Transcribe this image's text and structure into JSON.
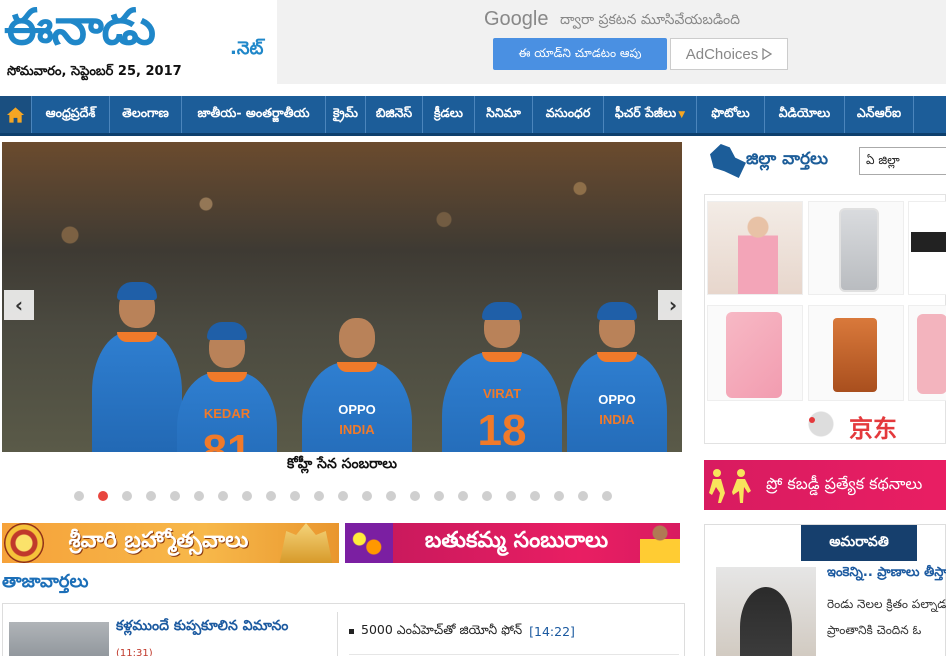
{
  "header": {
    "logo_main": "ఈనాడు",
    "logo_suffix": ".నెట్",
    "date": "సోమవారం, సెప్టెంబర్ 25, 2017",
    "ad": {
      "google": "Google",
      "google_text": "ద్వారా ప్రకటన మూసివేయబడింది",
      "view_button": "ఈ యాడ్‌ని చూడటం ఆపు",
      "adchoices": "AdChoices"
    }
  },
  "nav": {
    "home_icon": "home-icon",
    "items": [
      {
        "label": "ఆంధ్రప్రదేశ్"
      },
      {
        "label": "తెలంగాణ"
      },
      {
        "label": "జాతీయ- అంతర్జాతీయ"
      },
      {
        "label": "క్రైమ్"
      },
      {
        "label": "బిజినెస్"
      },
      {
        "label": "క్రీడలు"
      },
      {
        "label": "సినిమా"
      },
      {
        "label": "వసుంధర"
      },
      {
        "label": "ఫీచర్ పేజీలు"
      },
      {
        "label": "ఫొటోలు"
      },
      {
        "label": "వీడియోలు"
      },
      {
        "label": "ఎన్ఆర్ఐ"
      }
    ],
    "accent": "#1c5d99"
  },
  "slider": {
    "caption": "కోహ్లీ సేన సంబరాలు",
    "prev": "‹",
    "next": "›",
    "dot_count": 23,
    "active_dot": 2,
    "players": [
      {
        "name": "KEDAR",
        "number": "81"
      },
      {
        "name": "VIRAT",
        "number": "18"
      }
    ],
    "jersey_text": "INDIA",
    "sponsor": "OPPO"
  },
  "banners": {
    "left": "శ్రీవారి బ్రహ్మోత్సవాలు",
    "right": "బతుకమ్మ సంబురాలు"
  },
  "latest": {
    "title": "తాజావార్తలు",
    "headline": "కళ్లముందే కుప్పకూలిన విమానం",
    "sub": "(11:31)",
    "item_text": "5000 ఎంఏహెచ్‌తో జియోనీ ఫోన్",
    "item_time": "[14:22]"
  },
  "sidebar": {
    "district_title": "జిల్లా వార్తలు",
    "district_select": "ఏ జిల్లా",
    "jd_logo": "京东",
    "kabaddi": "ప్రో కబడ్డీ ప్రత్యేక కథనాలు",
    "amaravati_tab": "అమరావతి",
    "am_headline": "ఇంకెన్ని.. ప్రాణాలు తీస్తారు",
    "am_text1": "రెండు నెలల క్రితం పల్నాడు",
    "am_text2": "ప్రాంతానికి చెందిన ఓ"
  }
}
